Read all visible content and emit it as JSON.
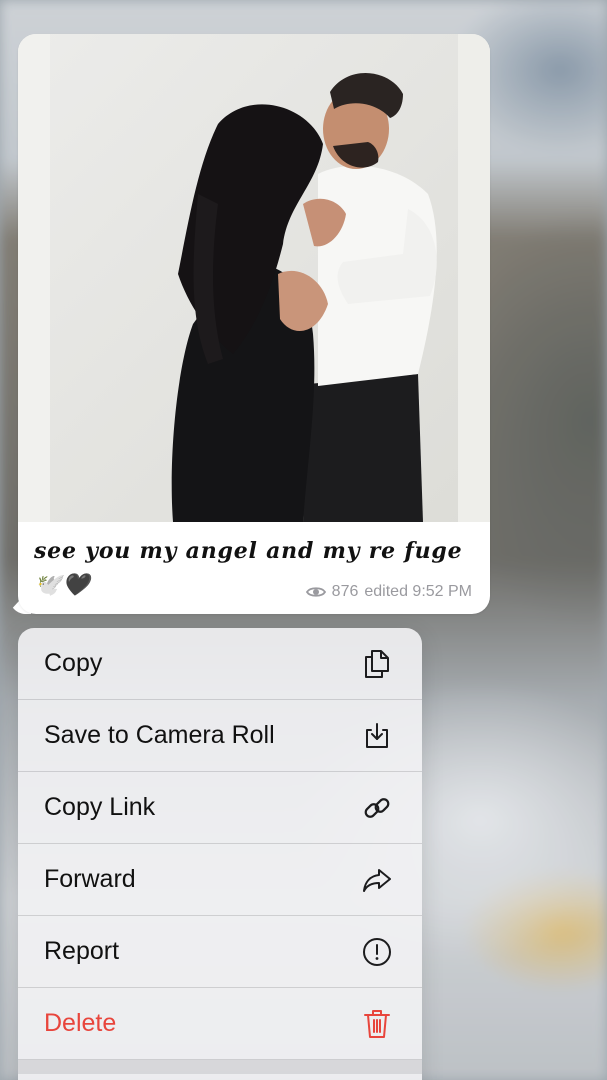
{
  "message": {
    "caption": "see you my angel and my re fuge🕊️🖤",
    "views": "876",
    "edited_time": "edited 9:52 PM"
  },
  "menu": {
    "items": [
      {
        "label": "Copy",
        "icon": "copy-icon"
      },
      {
        "label": "Save to Camera Roll",
        "icon": "save-download-icon"
      },
      {
        "label": "Copy Link",
        "icon": "link-icon"
      },
      {
        "label": "Forward",
        "icon": "forward-arrow-icon"
      },
      {
        "label": "Report",
        "icon": "exclamation-circle-icon"
      },
      {
        "label": "Delete",
        "icon": "trash-icon",
        "destructive": true
      }
    ]
  },
  "colors": {
    "destructive": "#e8453c",
    "meta_text": "#9a9a9f",
    "bubble": "#ffffff"
  }
}
